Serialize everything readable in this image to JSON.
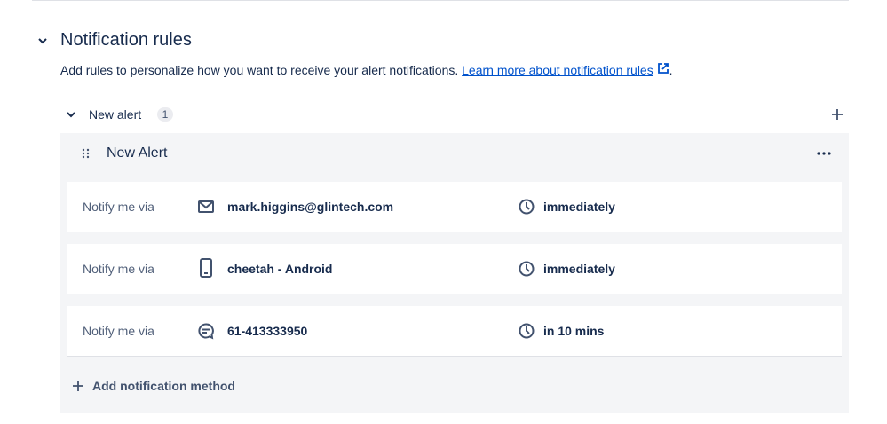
{
  "section": {
    "title": "Notification rules",
    "description": "Add rules to personalize how you want to receive your alert notifications.",
    "link": "Learn more about notification rules",
    "period": "."
  },
  "group": {
    "label": "New alert",
    "count": "1"
  },
  "alert": {
    "title": "New Alert"
  },
  "rows": [
    {
      "label": "Notify me via",
      "target": "mark.higgins@glintech.com",
      "icon": "email-icon",
      "timing": "immediately"
    },
    {
      "label": "Notify me via",
      "target": "cheetah - Android",
      "icon": "mobile-icon",
      "timing": "immediately"
    },
    {
      "label": "Notify me via",
      "target": "61-413333950",
      "icon": "sms-icon",
      "timing": "in 10 mins"
    }
  ],
  "add_method": "Add notification method"
}
